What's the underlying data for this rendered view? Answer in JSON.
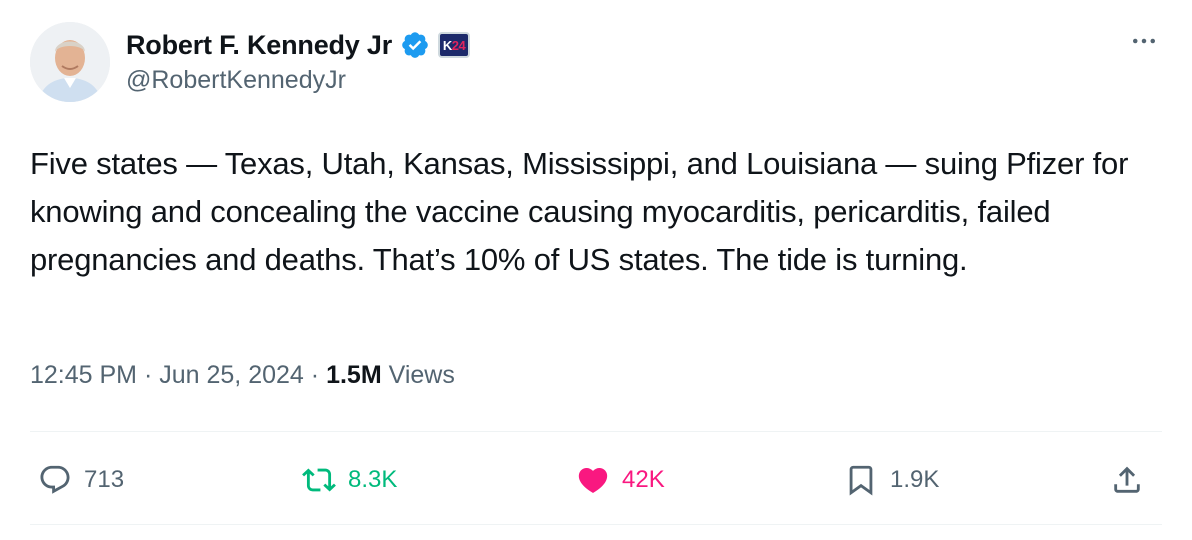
{
  "author": {
    "display_name": "Robert F. Kennedy Jr",
    "handle": "@RobertKennedyJr",
    "verified_icon": "verified-badge-icon",
    "affiliate_badge": {
      "text_a": "K",
      "text_b": "24"
    }
  },
  "tweet": {
    "text": "Five states — Texas, Utah, Kansas, Mississippi, and Louisiana — suing Pfizer for knowing and concealing the vaccine causing myocarditis, pericarditis, failed pregnancies and deaths. That’s 10% of US states. The tide is turning.",
    "time": "12:45 PM",
    "separator": "·",
    "date": "Jun 25, 2024",
    "views_count": "1.5M",
    "views_label": "Views"
  },
  "actions": {
    "reply_count": "713",
    "retweet_count": "8.3K",
    "like_count": "42K",
    "bookmark_count": "1.9K"
  },
  "colors": {
    "text_primary": "#0f1419",
    "text_secondary": "#536471",
    "verified_blue": "#1d9bf0",
    "retweet_green": "#00ba7c",
    "like_pink": "#f91880",
    "divider": "#eff3f4"
  }
}
